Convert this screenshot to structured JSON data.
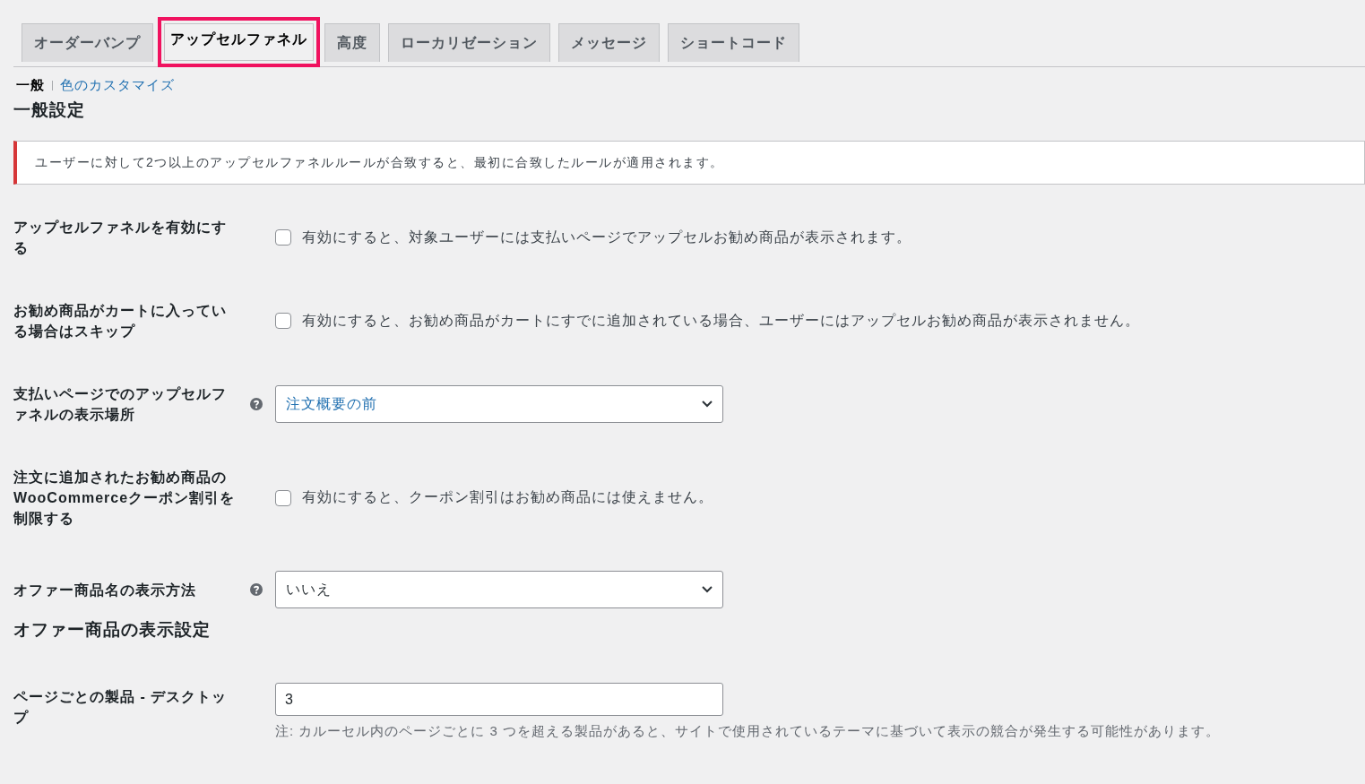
{
  "tabs": [
    {
      "label": "オーダーバンプ",
      "selected": false,
      "highlighted": false
    },
    {
      "label": "アップセルファネル",
      "selected": true,
      "highlighted": true
    },
    {
      "label": "高度",
      "selected": false,
      "highlighted": false
    },
    {
      "label": "ローカリゼーション",
      "selected": false,
      "highlighted": false
    },
    {
      "label": "メッセージ",
      "selected": false,
      "highlighted": false
    },
    {
      "label": "ショートコード",
      "selected": false,
      "highlighted": false
    }
  ],
  "subnav": [
    {
      "label": "一般",
      "selected": true
    },
    {
      "label": "色のカスタマイズ",
      "selected": false
    }
  ],
  "heading": "一般設定",
  "notice": "ユーザーに対して2つ以上のアップセルファネルルールが合致すると、最初に合致したルールが適用されます。",
  "settings": [
    {
      "kind": "checkbox",
      "label": "アップセルファネルを有効にする",
      "help": false,
      "checked": false,
      "description": "有効にすると、対象ユーザーには支払いページでアップセルお勧め商品が表示されます。"
    },
    {
      "kind": "checkbox",
      "label": "お勧め商品がカートに入っている場合はスキップ",
      "help": false,
      "checked": false,
      "description": "有効にすると、お勧め商品がカートにすでに追加されている場合、ユーザーにはアップセルお勧め商品が表示されません。"
    },
    {
      "kind": "select",
      "label": "支払いページでのアップセルファネルの表示場所",
      "help": true,
      "value": "注文概要の前",
      "linked": true
    },
    {
      "kind": "checkbox",
      "label": "注文に追加されたお勧め商品のWooCommerceクーポン割引を制限する",
      "help": false,
      "checked": false,
      "description": "有効にすると、クーポン割引はお勧め商品には使えません。"
    },
    {
      "kind": "select",
      "label": "オファー商品名の表示方法",
      "help": true,
      "value": "いいえ",
      "linked": false
    },
    {
      "kind": "heading",
      "label": "オファー商品の表示設定"
    },
    {
      "kind": "text",
      "label": "ページごとの製品 - デスクトップ",
      "help": false,
      "value": "3",
      "note": "注: カルーセル内のページごとに 3 つを超える製品があると、サイトで使用されているテーマに基づいて表示の競合が発生する可能性があります。"
    }
  ]
}
